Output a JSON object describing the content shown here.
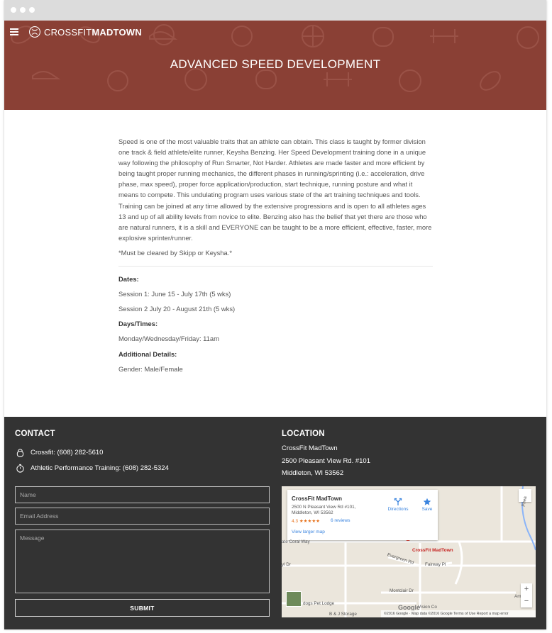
{
  "brand": {
    "name_light": "CROSSFIT",
    "name_bold": "MADTOWN"
  },
  "hero": {
    "title": "ADVANCED SPEED DEVELOPMENT",
    "bg_color": "#8a4035"
  },
  "content": {
    "paragraph": "Speed is one of the most valuable traits that an athlete can obtain. This class is taught by former division one track & field athlete/elite runner, Keysha Benzing. Her Speed Development training done in a unique way following the philosophy of Run Smarter, Not Harder. Athletes are made faster and more efficient by being taught proper running mechanics, the different phases in running/sprinting (i.e.: acceleration, drive phase, max speed), proper force application/production, start technique, running posture and what it means to compete. This undulating program uses various state of the art training techniques and tools. Training can be joined at any time allowed by the extensive progressions and is open to all athletes ages 13 and up of all ability levels from novice to elite. Benzing also has the belief that yet there are those who are natural runners, it is a skill and EVERYONE can be taught to be a more efficient, effective, faster, more explosive sprinter/runner.",
    "note": "*Must be cleared by Skipp or Keysha.*",
    "dates_label": "Dates:",
    "session1": "Session 1: June 15 - July 17th (5 wks)",
    "session2": "Session 2 July 20 - August 21th (5 wks)",
    "days_label": "Days/Times:",
    "days_value": "Monday/Wednesday/Friday: 11am",
    "details_label": "Additional Details:",
    "details_value": "Gender: Male/Female"
  },
  "footer": {
    "contact_heading": "CONTACT",
    "phone_crossfit": "Crossfit: (608) 282-5610",
    "phone_apt": "Athletic Performance Training: (608) 282-5324",
    "name_placeholder": "Name",
    "email_placeholder": "Email Address",
    "message_placeholder": "Message",
    "submit_label": "SUBMIT",
    "location_heading": "LOCATION",
    "addr_name": "CrossFit MadTown",
    "addr_line1": "2500 Pleasant View Rd. #101",
    "addr_line2": "Middleton, WI 53562"
  },
  "map": {
    "card_name": "CrossFit MadTown",
    "card_addr": "2500 N Pleasant View Rd #101, Middleton, WI 53562",
    "rating": "4.3 ★★★★★",
    "reviews": "6 reviews",
    "larger": "View larger map",
    "directions": "Directions",
    "save": "Save",
    "pin_label": "CrossFit MadTown",
    "streets": {
      "coral": "ate Coral Way",
      "evergreen": "Evergreen Rd",
      "fairway": "Fairway Pl",
      "montclair": "Montclair Dr",
      "dr": "yl Dr",
      "lodge": "dogs Pet Lodge",
      "storage": "B & J Storage",
      "vision": "Vision Co",
      "phea": "Phea",
      "am": "Am"
    },
    "attribution": "©2016 Google · Map data ©2016 Google   Terms of Use   Report a map error",
    "google": "Google"
  }
}
